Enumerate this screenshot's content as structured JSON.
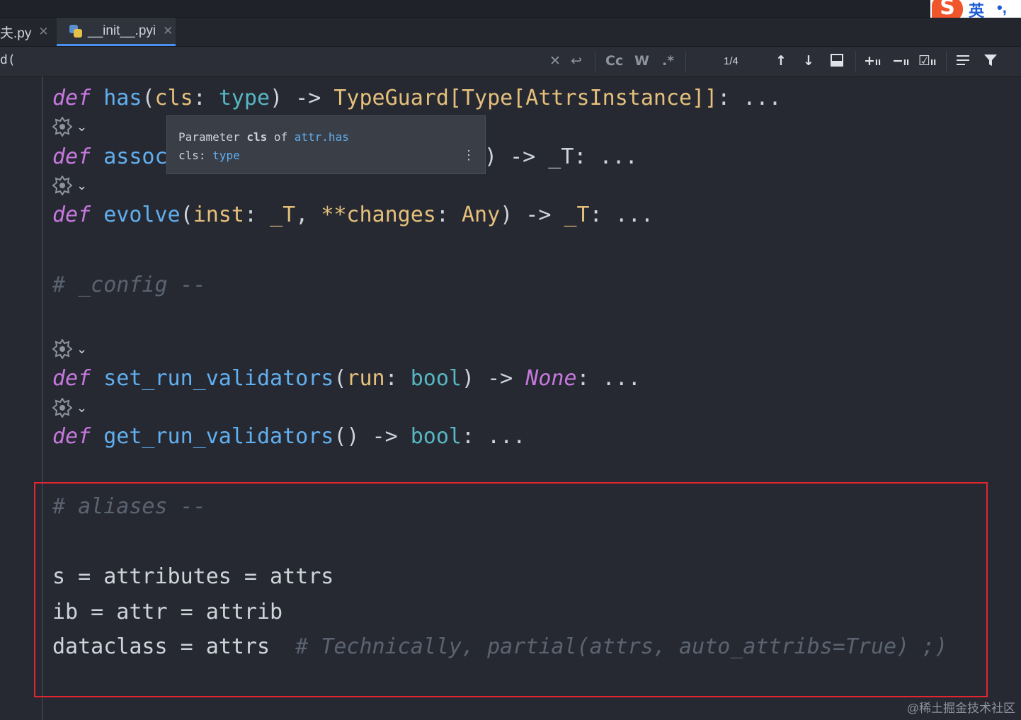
{
  "ime": {
    "logo": "S",
    "lang": "英",
    "punct": "•,"
  },
  "tabs": [
    {
      "label": "夫.py",
      "active": false
    },
    {
      "label": "__init__.pyi",
      "active": true
    }
  ],
  "search": {
    "query": "d(",
    "match_count": "1/4",
    "case_label": "Cc",
    "words_label": "W",
    "regex_label": ".*"
  },
  "tooltip": {
    "line1_prefix": "Parameter ",
    "line1_param": "cls",
    "line1_mid": " of ",
    "line1_link": "attr.has",
    "line2_prefix": "cls: ",
    "line2_type": "type",
    "more": "⋮"
  },
  "code": {
    "line_has": {
      "kw": "def",
      "name": "has",
      "p1": "cls",
      "t1": "type",
      "ret": "TypeGuard[Type[AttrsInstance]]",
      "tail": ": ..."
    },
    "line_assoc": {
      "kw": "def",
      "name": "assoc",
      "tail": ") -> _T: ..."
    },
    "line_evolve": {
      "kw": "def",
      "name": "evolve",
      "p1": "inst",
      "t1": "_T",
      "p2": "**changes",
      "t2": "Any",
      "ret": "_T",
      "tail": ": ..."
    },
    "comment_config": "# _config --",
    "line_setrun": {
      "kw": "def",
      "name": "set_run_validators",
      "p1": "run",
      "t1": "bool",
      "ret": "None",
      "tail": ": ..."
    },
    "line_getrun": {
      "kw": "def",
      "name": "get_run_validators",
      "ret": "bool",
      "tail": ": ..."
    },
    "comment_aliases": "# aliases --",
    "alias1": "s = attributes = attrs",
    "alias2": "ib = attr = attrib",
    "alias3_code": "dataclass = attrs",
    "alias3_comment": "# Technically, partial(attrs, auto_attribs=True) ;)"
  },
  "watermark": "@稀土掘金技术社区",
  "colors": {
    "keyword": "#c678dd",
    "function": "#61afef",
    "param": "#e5c07b",
    "type": "#56b6c2",
    "comment": "#5c6370",
    "highlight_box": "#e2252f"
  }
}
